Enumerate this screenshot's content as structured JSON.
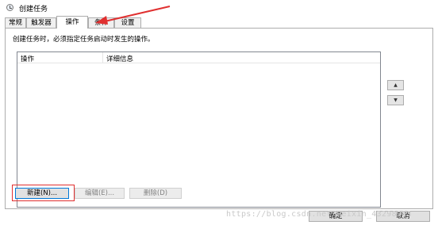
{
  "window": {
    "title": "创建任务"
  },
  "tabs": [
    {
      "label": "常规",
      "active": false
    },
    {
      "label": "触发器",
      "active": false
    },
    {
      "label": "操作",
      "active": true
    },
    {
      "label": "条件",
      "active": false
    },
    {
      "label": "设置",
      "active": false
    }
  ],
  "main": {
    "description": "创建任务时，必须指定任务启动时发生的操作。",
    "list": {
      "columns": [
        "操作",
        "详细信息"
      ],
      "rows": []
    },
    "move_up": "▲",
    "move_down": "▼"
  },
  "buttons": {
    "new": "新建(N)...",
    "edit": "编辑(E)...",
    "delete": "删除(D)"
  },
  "footer": {
    "ok": "确定",
    "cancel": "取消"
  },
  "watermark": "https://blog.csdn.net/weixin_43298913",
  "colors": {
    "annotation": "#e03030",
    "focus_border": "#0078d7"
  }
}
